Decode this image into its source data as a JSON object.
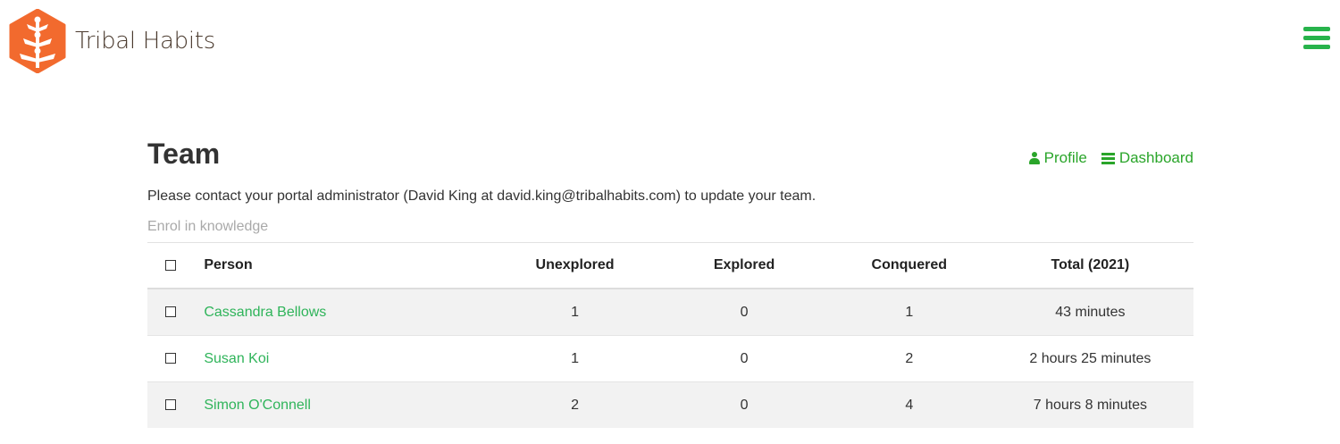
{
  "brand": {
    "name": "Tribal Habits",
    "accent": "#f26a2e",
    "link_color": "#2fb45a"
  },
  "header": {
    "menu_icon": "hamburger-icon"
  },
  "page": {
    "title": "Team",
    "links": [
      {
        "label": "Profile",
        "icon": "user-icon"
      },
      {
        "label": "Dashboard",
        "icon": "list-icon"
      }
    ],
    "notice": "Please contact your portal administrator (David King at david.king@tribalhabits.com) to update your team.",
    "enrol_label": "Enrol in knowledge"
  },
  "table": {
    "headers": [
      "Person",
      "Unexplored",
      "Explored",
      "Conquered",
      "Total (2021)"
    ],
    "rows": [
      {
        "person": "Cassandra Bellows",
        "unexplored": "1",
        "explored": "0",
        "conquered": "1",
        "total": "43 minutes"
      },
      {
        "person": "Susan Koi",
        "unexplored": "1",
        "explored": "0",
        "conquered": "2",
        "total": "2 hours 25 minutes"
      },
      {
        "person": "Simon O'Connell",
        "unexplored": "2",
        "explored": "0",
        "conquered": "4",
        "total": "7 hours 8 minutes"
      }
    ]
  }
}
